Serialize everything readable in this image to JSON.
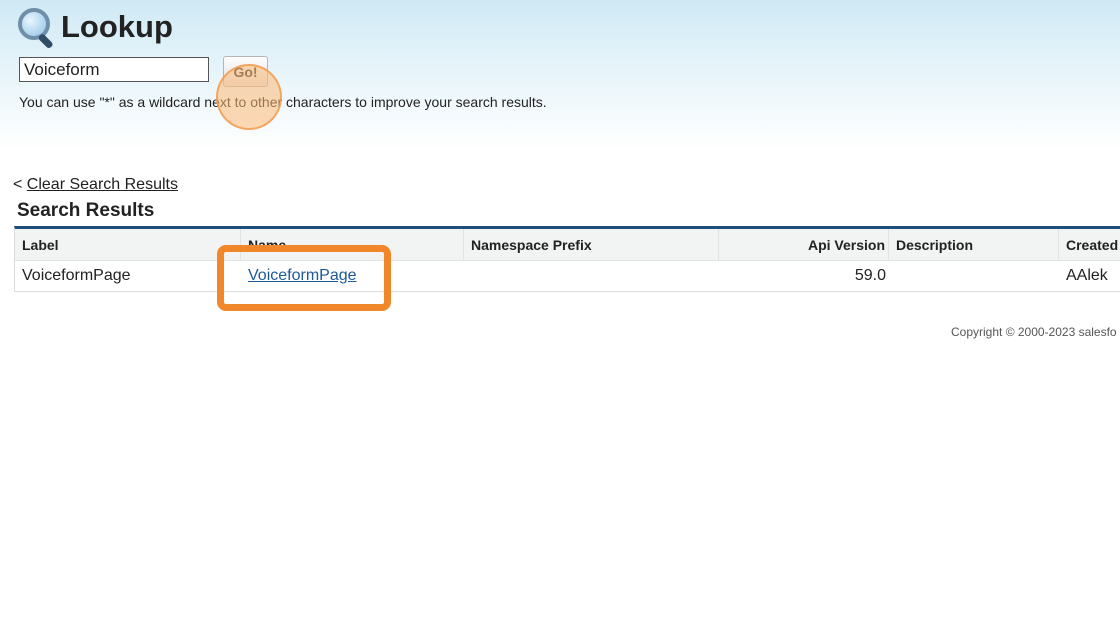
{
  "header": {
    "title": "Lookup",
    "icon": "magnifier-icon"
  },
  "search": {
    "value": "Voiceform",
    "go_label": "Go!",
    "hint": "You can use \"*\" as a wildcard next to other characters to improve your search results."
  },
  "results": {
    "clear_prefix": "<",
    "clear_label": "Clear Search Results",
    "title": "Search Results",
    "columns": [
      "Label",
      "Name",
      "Namespace Prefix",
      "Api Version",
      "Description",
      "Created"
    ],
    "rows": [
      {
        "label": "VoiceformPage",
        "name": "VoiceformPage",
        "namespace": "",
        "api_version": "59.0",
        "description": "",
        "created": "AAlek"
      }
    ]
  },
  "footer": {
    "copyright": "Copyright © 2000-2023 salesfo"
  },
  "colors": {
    "accent_border": "#1f4e79",
    "link": "#1e5a96",
    "highlight": "#f0872b"
  }
}
